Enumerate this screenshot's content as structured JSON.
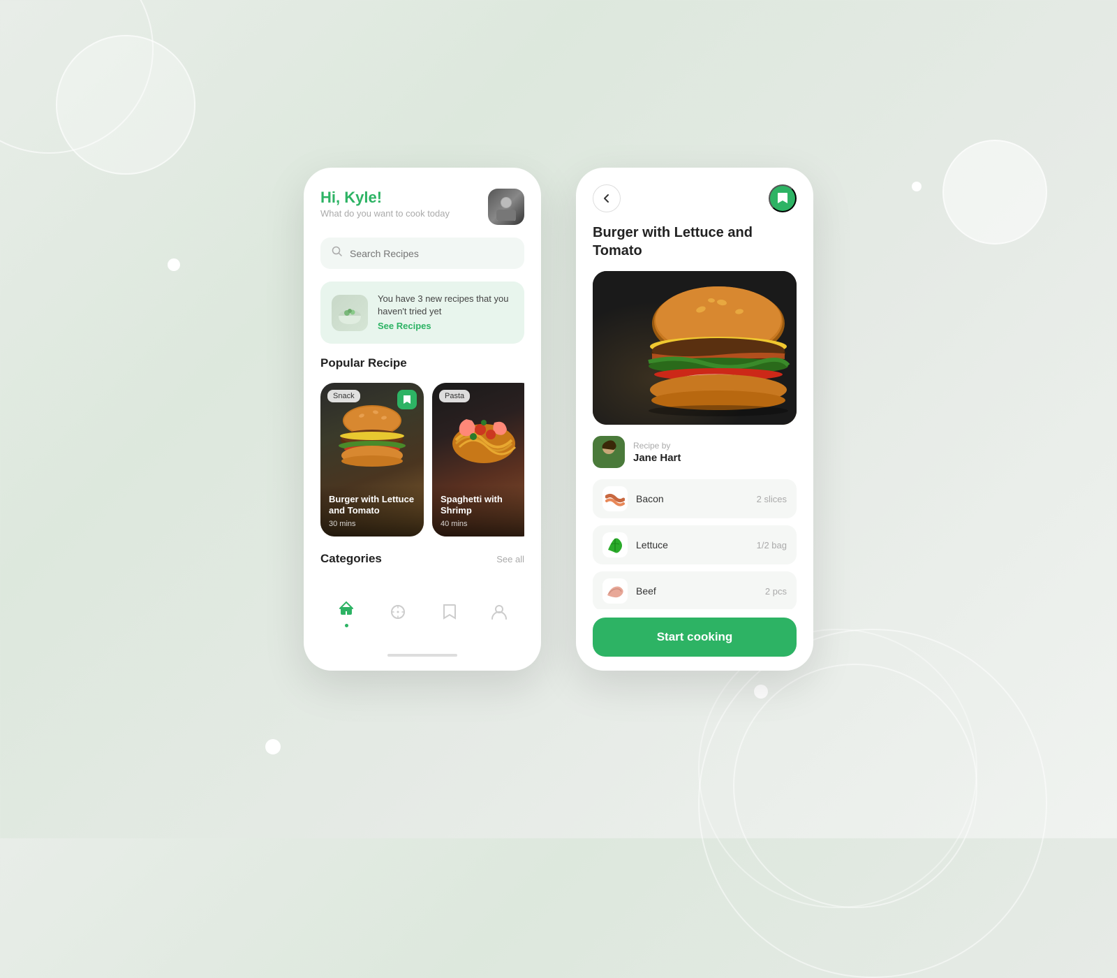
{
  "background": {
    "color": "#e5eae5"
  },
  "left_phone": {
    "greeting": {
      "title": "Hi, Kyle!",
      "subtitle": "What do you want to cook today"
    },
    "search": {
      "placeholder": "Search Recipes"
    },
    "notification": {
      "text": "You have 3 new recipes that you haven't tried yet",
      "link_label": "See Recipes"
    },
    "popular_section": {
      "title": "Popular Recipe",
      "recipes": [
        {
          "name": "Burger with Lettuce and Tomato",
          "tag": "Snack",
          "time": "30 mins",
          "emoji": "🍔"
        },
        {
          "name": "Spaghetti with Shrimp",
          "tag": "Pasta",
          "time": "40 mins",
          "emoji": "🍝"
        }
      ]
    },
    "categories_section": {
      "title": "Categories",
      "see_all": "See all"
    },
    "nav": {
      "items": [
        {
          "icon": "home",
          "active": true
        },
        {
          "icon": "compass",
          "active": false
        },
        {
          "icon": "bookmark",
          "active": false
        },
        {
          "icon": "user",
          "active": false
        }
      ]
    }
  },
  "right_phone": {
    "title": "Burger with Lettuce and Tomato",
    "author": {
      "label": "Recipe by",
      "name": "Jane Hart"
    },
    "ingredients": [
      {
        "name": "Bacon",
        "qty": "2 slices",
        "emoji": "🥓"
      },
      {
        "name": "Lettuce",
        "qty": "1/2 bag",
        "emoji": "🥬"
      },
      {
        "name": "Beef",
        "qty": "2 pcs",
        "emoji": "🥩"
      }
    ],
    "cta_label": "Start cooking"
  }
}
